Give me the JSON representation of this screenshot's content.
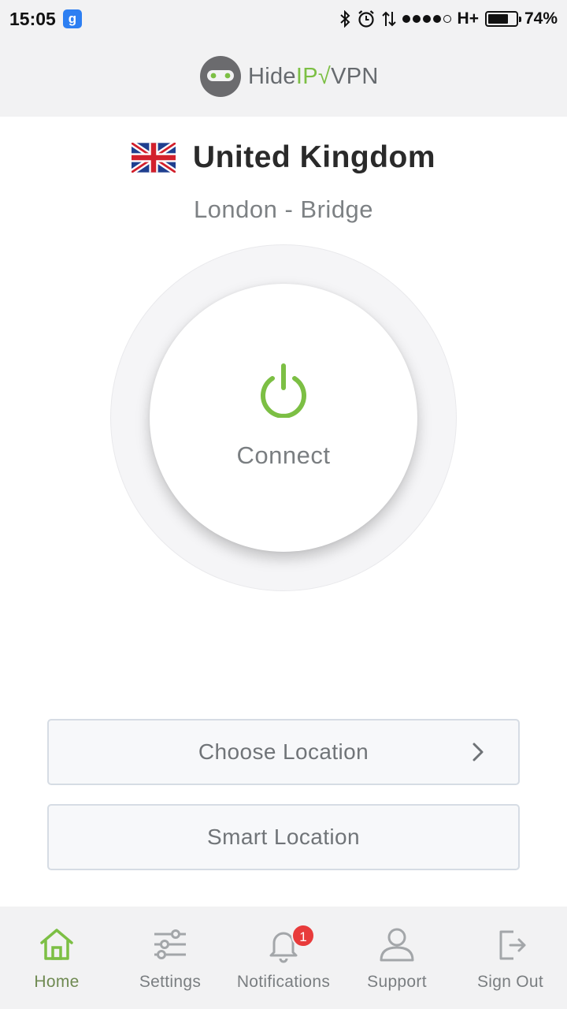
{
  "status_bar": {
    "time": "15:05",
    "notif_icon_letter": "g",
    "network": "H+",
    "battery_percent": "74%",
    "battery_level": 0.74,
    "signal_bars_filled": 4,
    "signal_bars_total": 5
  },
  "brand": {
    "name_part1": "Hide",
    "name_part2": "IP",
    "name_part3": "VPN",
    "accent_color": "#7cbf44"
  },
  "location": {
    "country": "United Kingdom",
    "city": "London - Bridge",
    "flag_icon": "uk-flag-icon"
  },
  "connect": {
    "label": "Connect",
    "icon": "power-icon",
    "icon_color": "#7cbf44"
  },
  "buttons": {
    "choose_location": "Choose Location",
    "smart_location": "Smart Location"
  },
  "tabs": [
    {
      "label": "Home",
      "icon": "home-icon",
      "active": true
    },
    {
      "label": "Settings",
      "icon": "sliders-icon",
      "active": false
    },
    {
      "label": "Notifications",
      "icon": "bell-icon",
      "active": false,
      "badge": "1"
    },
    {
      "label": "Support",
      "icon": "user-icon",
      "active": false
    },
    {
      "label": "Sign Out",
      "icon": "sign-out-icon",
      "active": false
    }
  ]
}
